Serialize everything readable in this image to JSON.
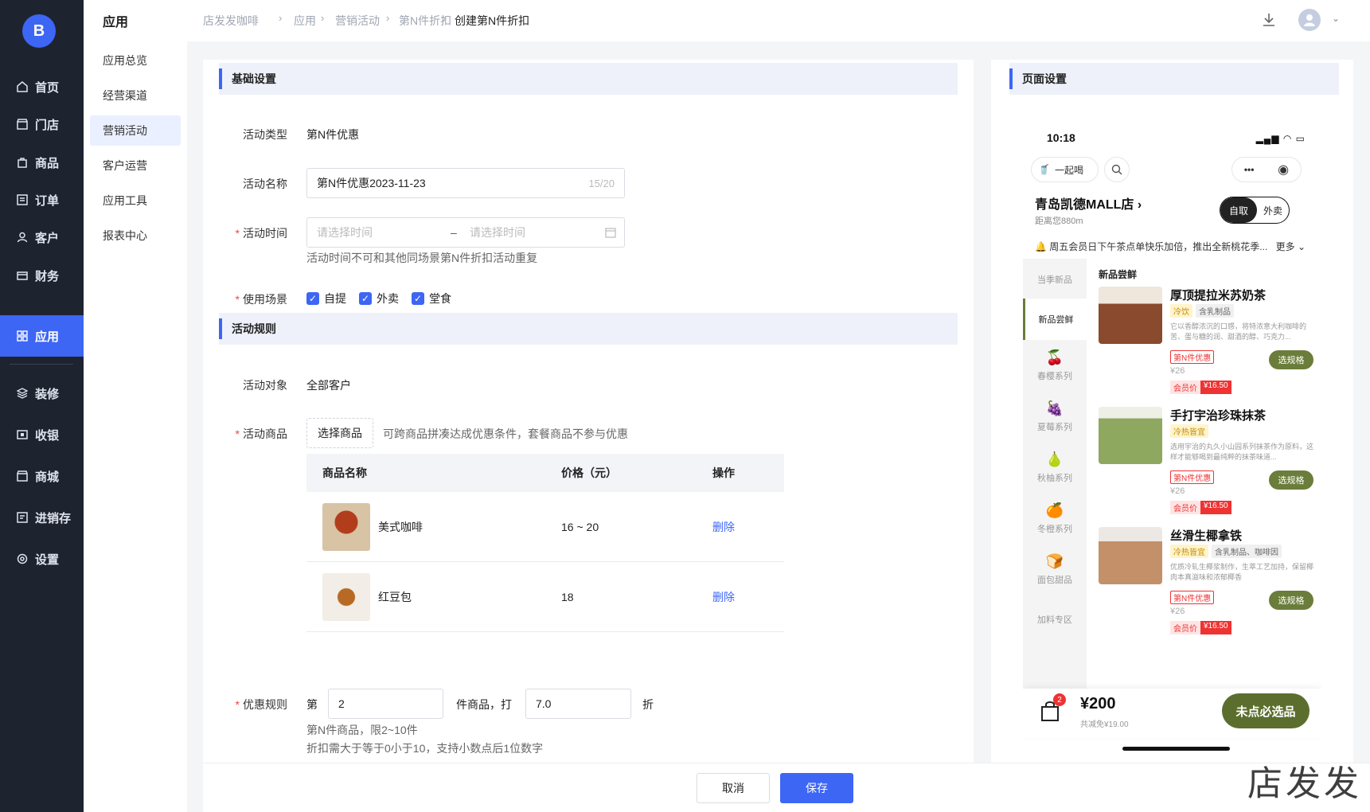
{
  "sidebar": {
    "logo_text": "B",
    "items": [
      {
        "label": "首页",
        "icon": "home-icon"
      },
      {
        "label": "门店",
        "icon": "store-icon"
      },
      {
        "label": "商品",
        "icon": "bag-icon"
      },
      {
        "label": "订单",
        "icon": "order-icon"
      },
      {
        "label": "客户",
        "icon": "user-icon"
      },
      {
        "label": "财务",
        "icon": "wallet-icon"
      },
      {
        "label": "应用",
        "icon": "apps-icon"
      },
      {
        "label": "装修",
        "icon": "layers-icon"
      },
      {
        "label": "收银",
        "icon": "cashier-icon"
      },
      {
        "label": "商城",
        "icon": "shop-icon"
      },
      {
        "label": "进销存",
        "icon": "inventory-icon"
      },
      {
        "label": "设置",
        "icon": "gear-icon"
      }
    ],
    "active_index": 6
  },
  "subnav": {
    "title": "应用",
    "items": [
      "应用总览",
      "经营渠道",
      "营销活动",
      "客户运营",
      "应用工具",
      "报表中心"
    ],
    "active_index": 2
  },
  "breadcrumb": [
    "店发发咖啡",
    "应用",
    "营销活动",
    "第N件折扣",
    "创建第N件折扣"
  ],
  "form": {
    "basic_section": "基础设置",
    "type_label": "活动类型",
    "type_value": "第N件优惠",
    "name_label": "活动名称",
    "name_value": "第N件优惠2023-11-23",
    "name_count": "15/20",
    "time_label": "活动时间",
    "time_start_placeholder": "请选择时间",
    "time_sep": "–",
    "time_end_placeholder": "请选择时间",
    "time_hint": "活动时间不可和其他同场景第N件折扣活动重复",
    "scene_label": "使用场景",
    "scenes": [
      "自提",
      "外卖",
      "堂食"
    ],
    "rules_section": "活动规则",
    "target_label": "活动对象",
    "target_value": "全部客户",
    "goods_label": "活动商品",
    "select_goods_btn": "选择商品",
    "goods_hint": "可跨商品拼凑达成优惠条件，套餐商品不参与优惠",
    "table_headers": [
      "商品名称",
      "价格（元）",
      "操作"
    ],
    "products": [
      {
        "name": "美式咖啡",
        "price": "16 ~ 20",
        "op": "删除"
      },
      {
        "name": "红豆包",
        "price": "18",
        "op": "删除"
      }
    ],
    "rule_label": "优惠规则",
    "rule_prefix": "第",
    "rule_n": "2",
    "rule_mid": "件商品，打",
    "rule_discount": "7.0",
    "rule_suffix": "折",
    "rule_hint1": "第N件商品，限2~10件",
    "rule_hint2": "折扣需大于等于0小于10，支持小数点后1位数字"
  },
  "footer": {
    "cancel": "取消",
    "save": "保存"
  },
  "watermark": "店发发",
  "preview": {
    "section": "页面设置",
    "time": "10:18",
    "together": "一起喝",
    "store": "青岛凯德MALL店",
    "distance": "距离您880m",
    "toggle_on": "自取",
    "toggle_off": "外卖",
    "notice": "周五会员日下午茶点单快乐加倍，推出全新桃花季...",
    "more": "更多",
    "categories": [
      {
        "label": "当季新品",
        "emoji": ""
      },
      {
        "label": "新品尝鲜",
        "emoji": ""
      },
      {
        "label": "春樱系列",
        "emoji": "🍒"
      },
      {
        "label": "夏莓系列",
        "emoji": "🍇"
      },
      {
        "label": "秋柚系列",
        "emoji": "🍐"
      },
      {
        "label": "冬橙系列",
        "emoji": "🍊"
      },
      {
        "label": "面包甜品",
        "emoji": "🍞"
      },
      {
        "label": "加料专区",
        "emoji": ""
      }
    ],
    "section_title": "新品尝鲜",
    "products": [
      {
        "name": "厚顶提拉米苏奶茶",
        "tags": [
          "冷饮",
          "含乳制品"
        ],
        "desc": "它以香醇浓沉的口感，将特浓意大利咖啡的苦、蛋与糖的润、甜酒的醇、巧克力...",
        "discount": "第N件优惠",
        "price": "¥26",
        "member_label": "会员价",
        "member_price": "¥16.50",
        "spec": "选规格"
      },
      {
        "name": "手打宇治珍珠抹茶",
        "tags": [
          "冷热皆宜"
        ],
        "desc": "选用宇治的丸久小山园系列抹茶作为原料，这样才能够喝到最纯粹的抹茶味道...",
        "discount": "第N件优惠",
        "price": "¥26",
        "member_label": "会员价",
        "member_price": "¥16.50",
        "spec": "选规格"
      },
      {
        "name": "丝滑生椰拿铁",
        "tags": [
          "冷热皆宜",
          "含乳制品、咖啡因"
        ],
        "desc": "优质冷轧生椰浆制作，生萃工艺加持，保留椰肉本真滋味和浓郁椰香",
        "discount": "第N件优惠",
        "price": "¥26",
        "member_label": "会员价",
        "member_price": "¥16.50",
        "spec": "选规格"
      }
    ],
    "cart_badge": "2",
    "cart_total": "¥200",
    "cart_saved": "共减免¥19.00",
    "must_btn": "未点必选品"
  },
  "colors": {
    "primary": "#3d66f5",
    "sidebar_bg": "#1e2330",
    "accent_green": "#5c6e2e",
    "danger": "#e33333"
  }
}
